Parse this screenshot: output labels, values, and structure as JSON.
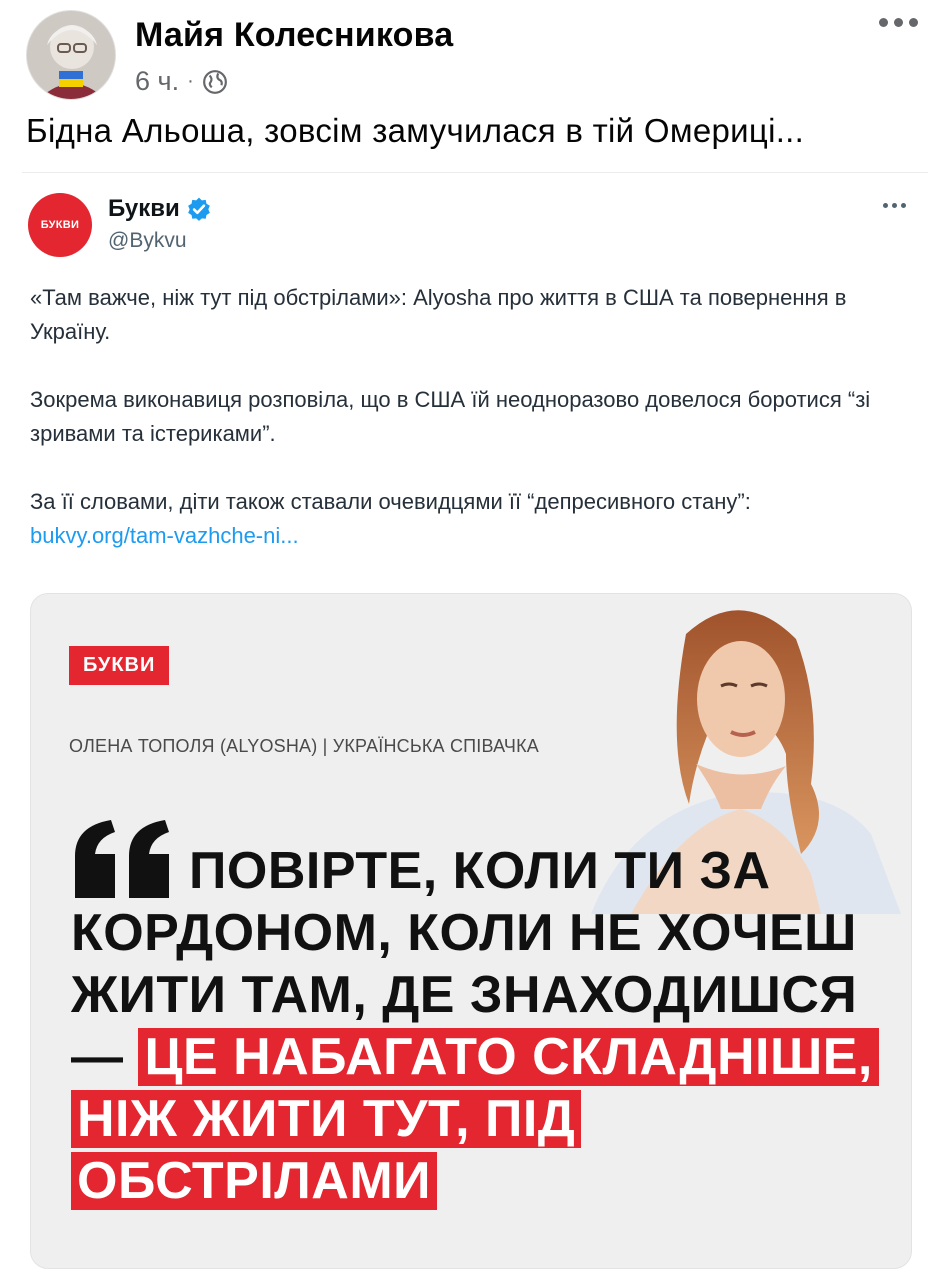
{
  "post": {
    "author": "Майя Колесникова",
    "time": "6 ч.",
    "separator": "·",
    "text": "Бідна Альоша, зовсім замучилася в тій Омериці..."
  },
  "tweet": {
    "avatar_text": "БУКВИ",
    "name": "Букви",
    "handle": "@Bykvu",
    "paragraphs": [
      "«Там важче, ніж тут під обстрілами»: Alyosha про життя в США та повернення в Україну.",
      "Зокрема виконавиця розповіла, що в США їй неодноразово довелося боротися “зі зривами та істериками”.",
      "За її словами, діти також ставали очевидцями її “депресивного стану”:"
    ],
    "link": "bukvy.org/tam-vazhche-ni..."
  },
  "card": {
    "logo": "БУКВИ",
    "caption": "ОЛЕНА ТОПОЛЯ (ALYOSHA) | УКРАЇНСЬКА СПІВАЧКА",
    "quote_main": "ПОВІРТЕ, КОЛИ ТИ ЗА КОРДОНОМ, КОЛИ НЕ ХОЧЕШ ЖИТИ ТАМ, ДЕ ЗНАХОДИШСЯ — ",
    "quote_highlight": "ЦЕ НАБАГАТО СКЛАДНІШЕ, НІЖ ЖИТИ ТУТ, ПІД ОБСТРІЛАМИ"
  },
  "colors": {
    "accent": "#e3262f",
    "link": "#1d9bf0",
    "meta": "#65676b"
  },
  "icons": [
    "avatar-photo",
    "globe-icon",
    "more-horizontal-icon",
    "verified-badge-icon",
    "quote-mark-icon"
  ]
}
